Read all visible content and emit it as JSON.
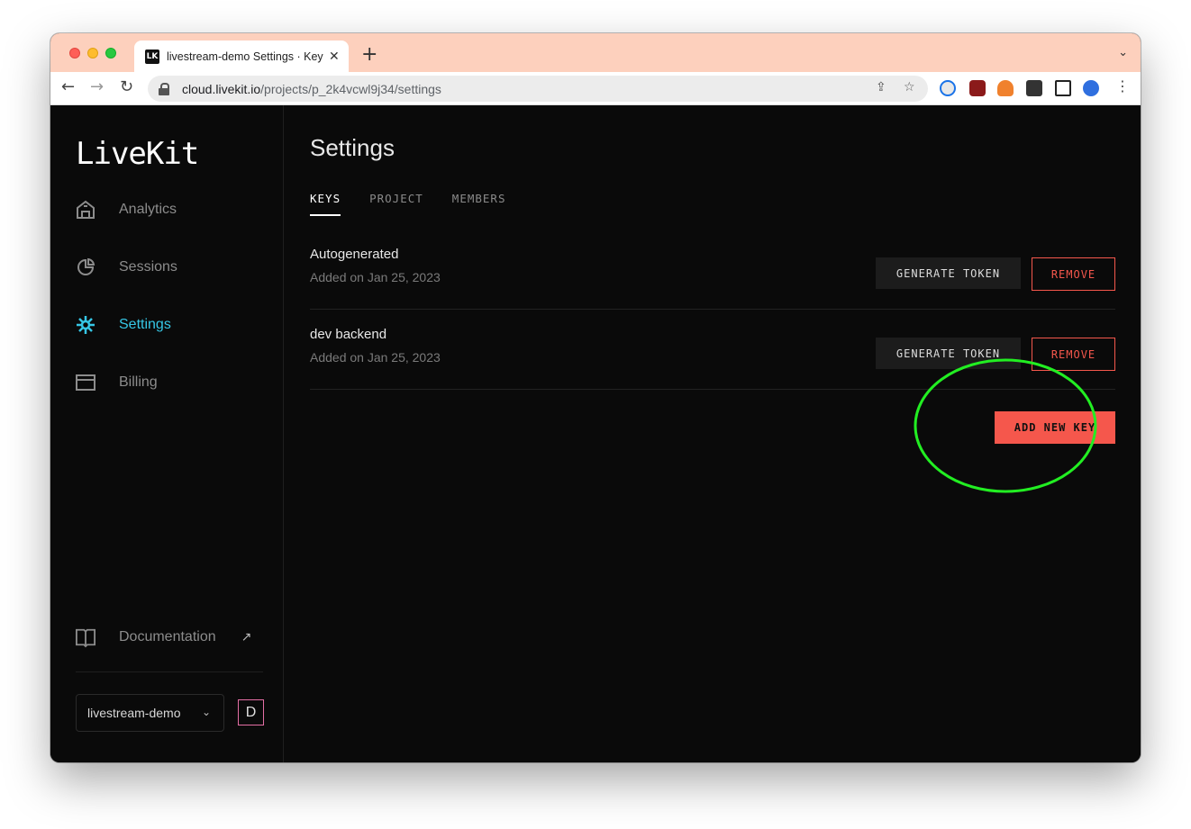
{
  "browser": {
    "tab_title": "livestream-demo Settings · Keys",
    "tab_close": "✕",
    "new_tab": "+",
    "favicon_text": "LK",
    "url_host": "cloud.livekit.io",
    "url_path": "/projects/p_2k4vcwl9j34/settings"
  },
  "sidebar": {
    "logo": "LiveKit",
    "items": [
      {
        "label": "Analytics",
        "icon": "building-icon",
        "active": false
      },
      {
        "label": "Sessions",
        "icon": "pie-chart-icon",
        "active": false
      },
      {
        "label": "Settings",
        "icon": "gear-icon",
        "active": true
      },
      {
        "label": "Billing",
        "icon": "card-icon",
        "active": false
      }
    ],
    "documentation": "Documentation",
    "external_arrow": "↗",
    "project": "livestream-demo",
    "avatar": "D"
  },
  "main": {
    "title": "Settings",
    "tabs": [
      {
        "label": "KEYS",
        "active": true
      },
      {
        "label": "PROJECT",
        "active": false
      },
      {
        "label": "MEMBERS",
        "active": false
      }
    ],
    "keys": [
      {
        "name": "Autogenerated",
        "date": "Added on Jan 25, 2023"
      },
      {
        "name": "dev backend",
        "date": "Added on Jan 25, 2023"
      }
    ],
    "generate_label": "GENERATE TOKEN",
    "remove_label": "REMOVE",
    "add_label": "ADD NEW KEY"
  },
  "colors": {
    "accent": "#36c7e6",
    "danger": "#f5574c",
    "highlight": "#22ee22",
    "background": "#0a0a0a"
  }
}
